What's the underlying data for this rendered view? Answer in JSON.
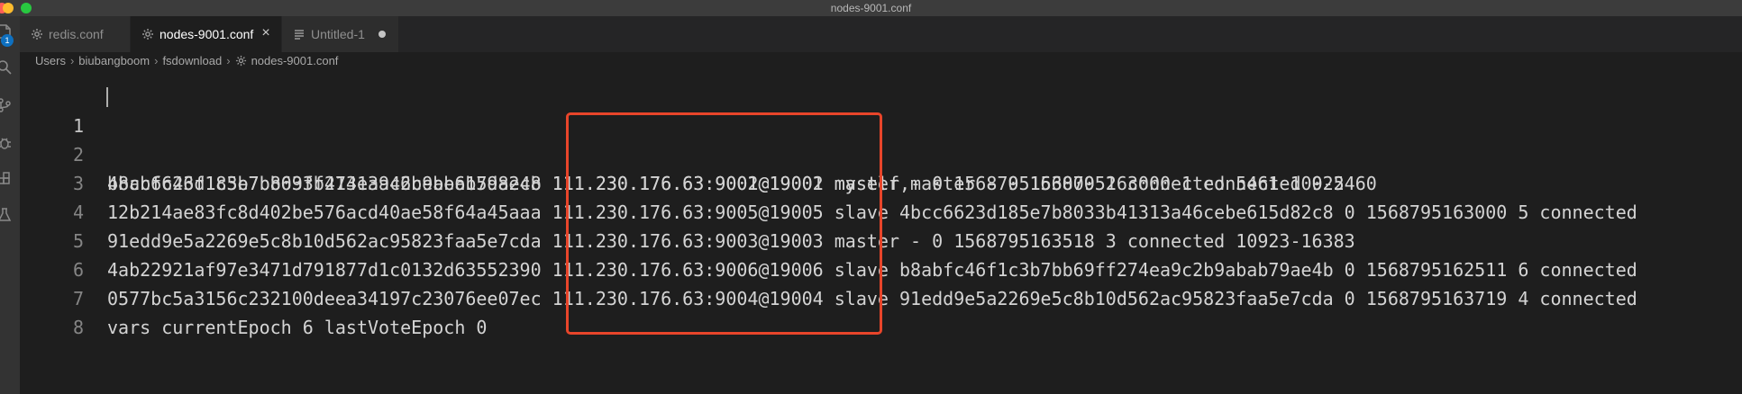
{
  "window": {
    "title": "nodes-9001.conf"
  },
  "activity": {
    "badge": "1"
  },
  "tabs": [
    {
      "label": "redis.conf",
      "icon": "gear-icon"
    },
    {
      "label": "nodes-9001.conf",
      "icon": "gear-icon",
      "close": "×"
    },
    {
      "label": "Untitled-1",
      "icon": "lines-icon"
    }
  ],
  "breadcrumb": [
    "Users",
    "biubangboom",
    "fsdownload",
    "nodes-9001.conf"
  ],
  "editor": {
    "lines": [
      {
        "num": "1",
        "text": "4bcc6623d185e7b8033b41313a46cebe615d82c8 111.230.176.63:9001@19001 myself,master - 0 1568795163000 1 connected 0-5460"
      },
      {
        "num": "2",
        "text": "b8abfc46f1c3b7bb69ff274ea9c2b9abab79ae4b 111.230.176.63:9002@19002 master - 0 1568795163000 2 connected 5461-10922"
      },
      {
        "num": "3",
        "text": "12b214ae83fc8d402be576acd40ae58f64a45aaa 111.230.176.63:9005@19005 slave 4bcc6623d185e7b8033b41313a46cebe615d82c8 0 1568795163000 5 connected"
      },
      {
        "num": "4",
        "text": "91edd9e5a2269e5c8b10d562ac95823faa5e7cda 111.230.176.63:9003@19003 master - 0 1568795163518 3 connected 10923-16383"
      },
      {
        "num": "5",
        "text": "4ab22921af97e3471d791877d1c0132d63552390 111.230.176.63:9006@19006 slave b8abfc46f1c3b7bb69ff274ea9c2b9abab79ae4b 0 1568795162511 6 connected"
      },
      {
        "num": "6",
        "text": "0577bc5a3156c232100deea34197c23076ee07ec 111.230.176.63:9004@19004 slave 91edd9e5a2269e5c8b10d562ac95823faa5e7cda 0 1568795163719 4 connected"
      },
      {
        "num": "7",
        "text": "vars currentEpoch 6 lastVoteEpoch 0"
      },
      {
        "num": "8",
        "text": ""
      }
    ]
  },
  "colors": {
    "highlight": "#e8452a",
    "badge": "#0e70c0"
  }
}
